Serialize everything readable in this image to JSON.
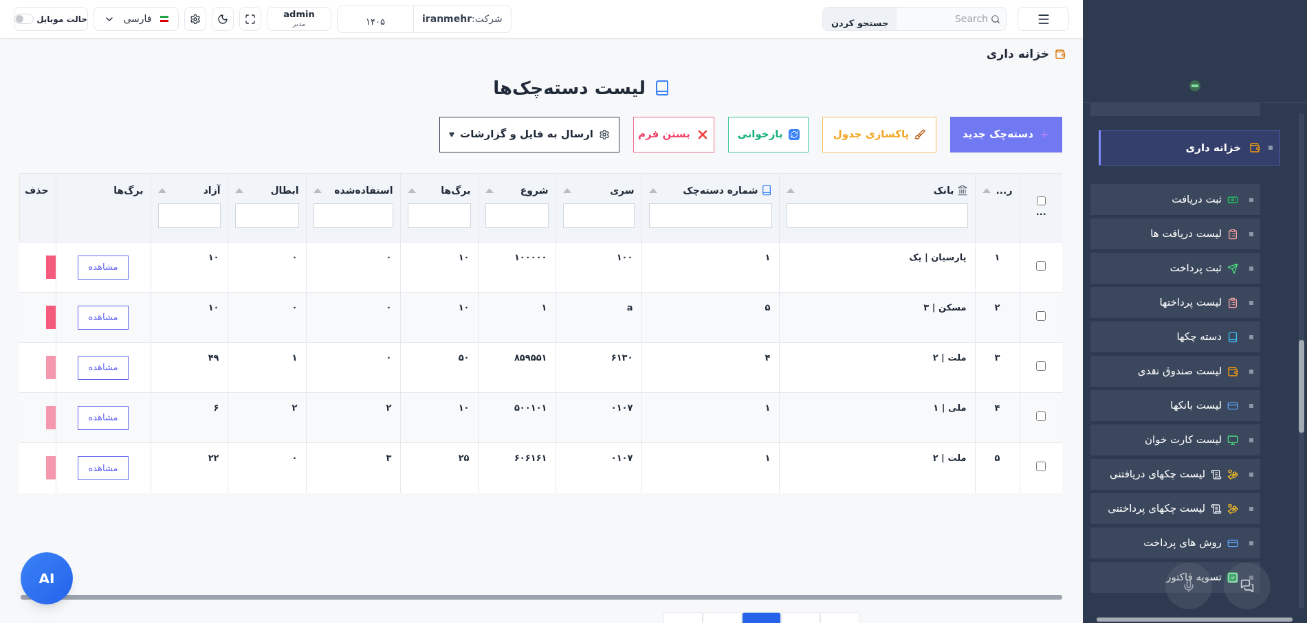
{
  "topbar": {
    "search": {
      "placeholder": "Search",
      "button": "جستجو کردن"
    },
    "company": {
      "label": "شرکت:",
      "value": "iranmehr",
      "year": "۱۴۰۵"
    },
    "user": {
      "name": "admin",
      "role": "مدیر"
    },
    "language": "فارسی",
    "mobile_mode": {
      "label": "حالت موبایل",
      "on": false
    }
  },
  "breadcrumb": "خزانه داری",
  "title": "لیست دسته‌چک‌ها",
  "actions": [
    {
      "kind": "primary",
      "label": "دسته‌چک جدید"
    },
    {
      "kind": "clear",
      "label": "پاکسازی جدول"
    },
    {
      "kind": "reload",
      "label": "بازخوانی"
    },
    {
      "kind": "close",
      "label": "بستن فرم"
    },
    {
      "kind": "export",
      "label": "ارسال به فایل و گزارشات"
    }
  ],
  "table": {
    "select_all": {
      "checked": false,
      "label": "..."
    },
    "columns": [
      {
        "label": "ر...",
        "filter": false
      },
      {
        "label": "بانک",
        "filter": true
      },
      {
        "label": "شماره دسته‌چک",
        "filter": true
      },
      {
        "label": "سری",
        "filter": true
      },
      {
        "label": "شروع",
        "filter": true
      },
      {
        "label": "برگ‌ها",
        "filter": true
      },
      {
        "label": "استفاده‌شده",
        "filter": true
      },
      {
        "label": "ابطال",
        "filter": true
      },
      {
        "label": "آزاد",
        "filter": true
      },
      {
        "label": "برگ‌ها",
        "filter": false
      },
      {
        "label": "حذف",
        "filter": false
      }
    ],
    "rows": [
      {
        "checked": false,
        "cells": [
          "۱",
          "پارسیان | یک",
          "۱",
          "۱۰۰",
          "۱۰۰۰۰۰",
          "۱۰",
          "۰",
          "۰",
          "۱۰"
        ],
        "view": "مشاهده",
        "delete_disabled": false
      },
      {
        "checked": false,
        "cells": [
          "۲",
          "مسکن | ۳",
          "۵",
          "a",
          "۱",
          "۱۰",
          "۰",
          "۰",
          "۱۰"
        ],
        "view": "مشاهده",
        "delete_disabled": false
      },
      {
        "checked": false,
        "cells": [
          "۳",
          "ملت | ۲",
          "۴",
          "۶۱۳۰",
          "۸۵۹۵۵۱",
          "۵۰",
          "۰",
          "۱",
          "۴۹"
        ],
        "view": "مشاهده",
        "delete_disabled": true
      },
      {
        "checked": false,
        "cells": [
          "۴",
          "ملی | ۱",
          "۱",
          "۰۱۰۷",
          "۵۰۰۱۰۱",
          "۱۰",
          "۲",
          "۲",
          "۶"
        ],
        "view": "مشاهده",
        "delete_disabled": true
      },
      {
        "checked": false,
        "cells": [
          "۵",
          "ملت | ۲",
          "۱",
          "۰۱۰۷",
          "۶۰۶۱۶۱",
          "۲۵",
          "۳",
          "۰",
          "۲۲"
        ],
        "view": "مشاهده",
        "delete_disabled": true
      }
    ]
  },
  "pagination": [
    {
      "selected": false
    },
    {
      "selected": false
    },
    {
      "selected": true
    },
    {
      "selected": false
    },
    {
      "selected": false
    }
  ],
  "ai_button": "AI",
  "sidebar": {
    "active": {
      "label": "خزانه داری",
      "selected": true
    },
    "items": [
      {
        "label": "ثبت دریافت"
      },
      {
        "label": "لیست دریافت ها"
      },
      {
        "label": "ثبت پرداخت"
      },
      {
        "label": "لیست پرداختها"
      },
      {
        "label": "دسته چکها"
      },
      {
        "label": "لیست صندوق نقدی"
      },
      {
        "label": "لیست بانکها"
      },
      {
        "label": "لیست کارت خوان"
      },
      {
        "label": "لیست چکهای دریافتنی"
      },
      {
        "label": "لیست چکهای پرداختنی"
      },
      {
        "label": "روش های پرداخت"
      },
      {
        "label": "تسویه فاکتور"
      }
    ]
  }
}
